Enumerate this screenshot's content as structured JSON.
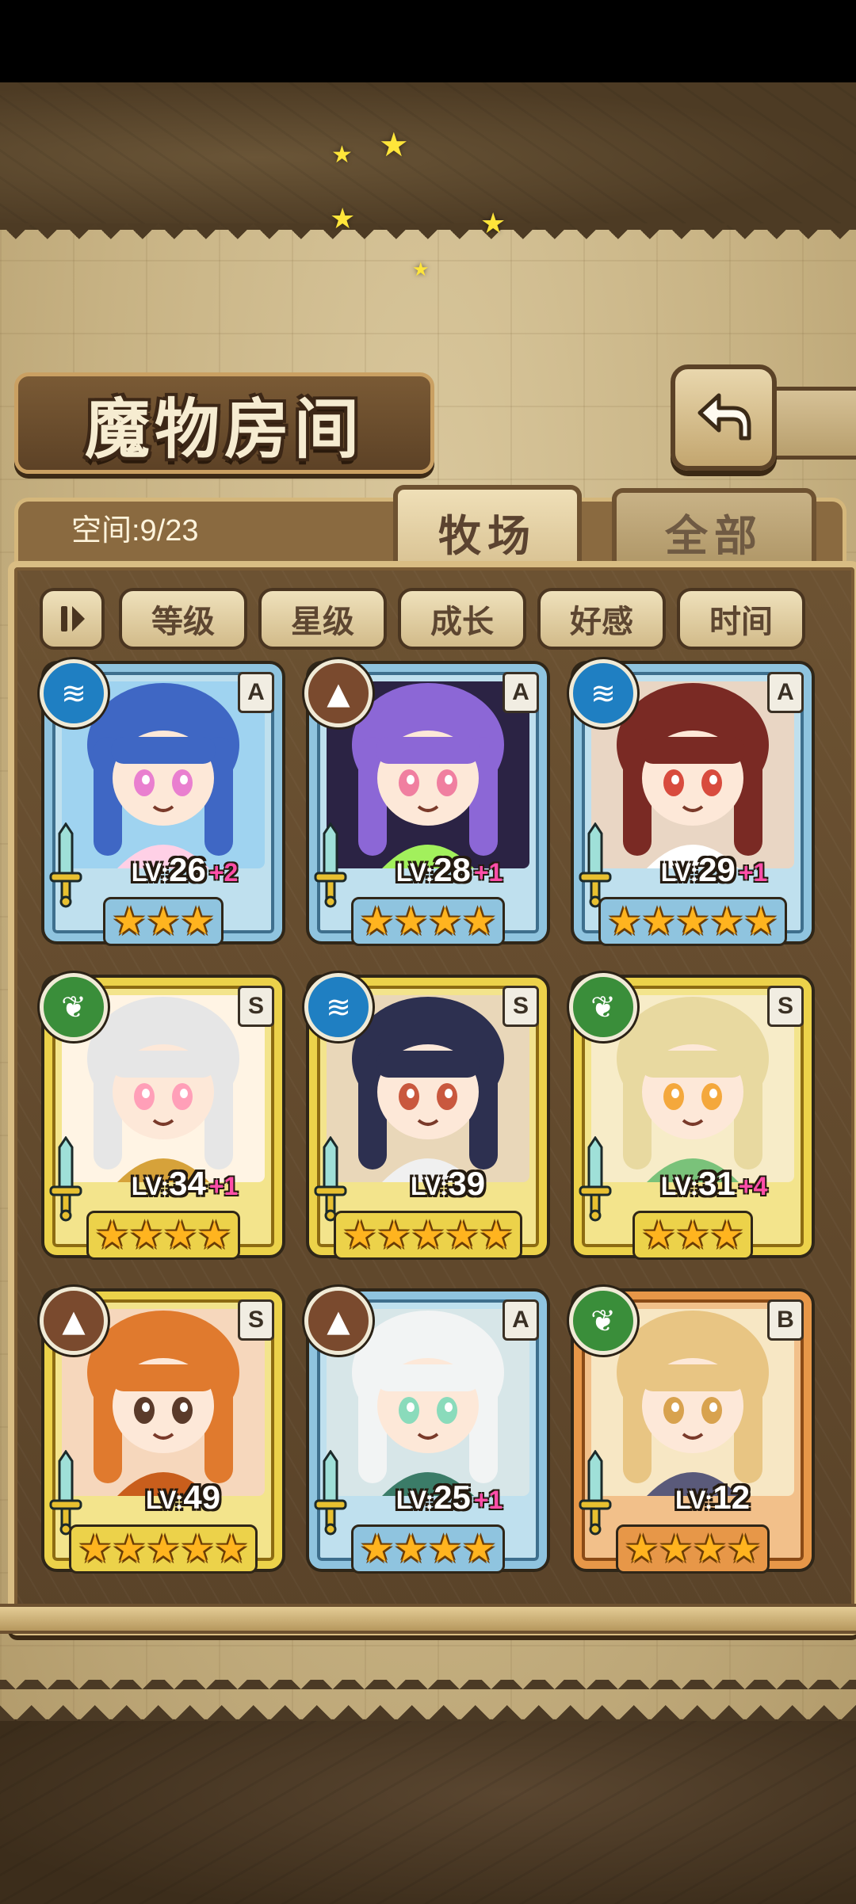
{
  "header": {
    "title": "魔物房间",
    "back_icon": "return-arrow-icon"
  },
  "tabs": {
    "space_label": "空间:9/23",
    "items": [
      {
        "label": "牧场",
        "active": true
      },
      {
        "label": "全部",
        "active": false
      }
    ]
  },
  "filters": {
    "toggle_icon": "sort-toggle-icon",
    "items": [
      {
        "label": "等级"
      },
      {
        "label": "星级"
      },
      {
        "label": "成长"
      },
      {
        "label": "好感"
      },
      {
        "label": "时间"
      }
    ]
  },
  "colors": {
    "frame_blue": "#7fb6d6",
    "frame_gold": "#e6c63e",
    "frame_orange": "#e0863b",
    "water": "#1f7fc2",
    "earth": "#7a4a2e",
    "wind": "#3a8e3a",
    "star": "#ffb41f",
    "bonus": "#ff4ea8"
  },
  "monsters": [
    {
      "element": "water",
      "rank": "A",
      "lv_prefix": "LV:",
      "level": "26",
      "bonus": "+2",
      "stars": 3,
      "frame": "blue"
    },
    {
      "element": "earth",
      "rank": "A",
      "lv_prefix": "LV:",
      "level": "28",
      "bonus": "+1",
      "stars": 4,
      "frame": "blue"
    },
    {
      "element": "water",
      "rank": "A",
      "lv_prefix": "LV:",
      "level": "29",
      "bonus": "+1",
      "stars": 5,
      "frame": "blue"
    },
    {
      "element": "wind",
      "rank": "S",
      "lv_prefix": "LV:",
      "level": "34",
      "bonus": "+1",
      "stars": 4,
      "frame": "gold"
    },
    {
      "element": "water",
      "rank": "S",
      "lv_prefix": "LV:",
      "level": "39",
      "bonus": "",
      "stars": 5,
      "frame": "gold"
    },
    {
      "element": "wind",
      "rank": "S",
      "lv_prefix": "LV:",
      "level": "31",
      "bonus": "+4",
      "stars": 3,
      "frame": "gold"
    },
    {
      "element": "earth",
      "rank": "S",
      "lv_prefix": "LV:",
      "level": "49",
      "bonus": "",
      "stars": 5,
      "frame": "gold"
    },
    {
      "element": "earth",
      "rank": "A",
      "lv_prefix": "LV:",
      "level": "25",
      "bonus": "+1",
      "stars": 4,
      "frame": "blue"
    },
    {
      "element": "wind",
      "rank": "B",
      "lv_prefix": "LV:",
      "level": "12",
      "bonus": "",
      "stars": 4,
      "frame": "orange"
    }
  ]
}
